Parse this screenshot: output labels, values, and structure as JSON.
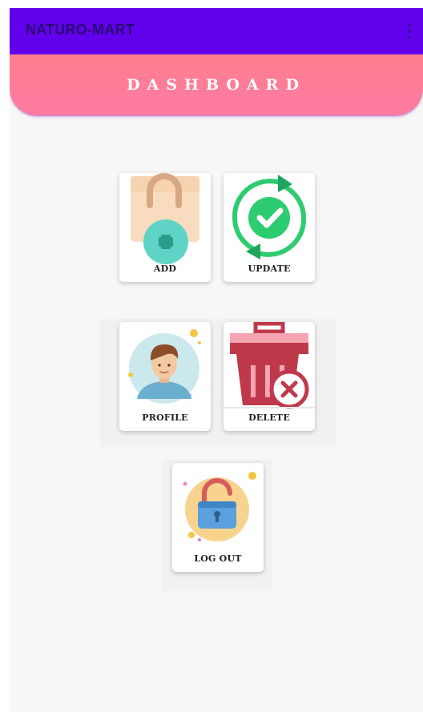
{
  "app": {
    "title": "NATURO-MART",
    "menu_icon": "more-vert-icon"
  },
  "dashboard": {
    "title": "DASHBOARD"
  },
  "tiles": {
    "add": {
      "label": "ADD",
      "icon": "shopping-bag-add-icon"
    },
    "update": {
      "label": "UPDATE",
      "icon": "refresh-check-icon"
    },
    "profile": {
      "label": "PROFILE",
      "icon": "user-avatar-icon"
    },
    "delete": {
      "label": "DELETE",
      "icon": "trash-delete-icon"
    },
    "logout": {
      "label": "LOG OUT",
      "icon": "unlock-icon"
    }
  },
  "colors": {
    "app_bar": "#6200ee",
    "banner": "#ff7f8e",
    "update_green": "#2ecc71",
    "delete_red": "#c0394b",
    "add_teal": "#5fd3c6"
  }
}
